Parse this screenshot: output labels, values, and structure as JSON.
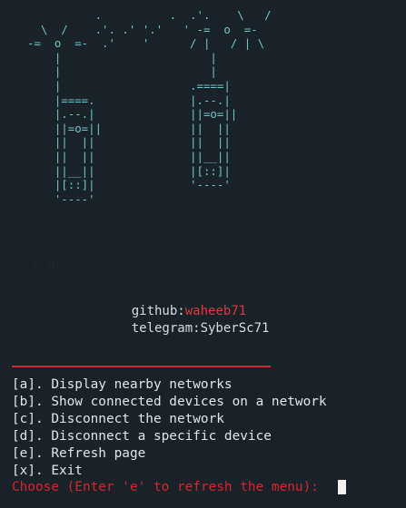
{
  "banner": {
    "art": "          .          .  .'.    \\   /\n  \\  /    .'. .' '.'   ' -=  o  =-\n-=  o  =-  .'    '      / |   / | \\\n    |                      |\n    |                      |\n    |                   .====|\n    |====.              |.--.|\n    |.--.|              ||=o=||\n    ||=o=||             ||  ||\n    ||  ||              ||  ||\n    ||  ||              ||__||\n    ||__||              |[::]|\n    |[::]|              '----'\n    '----'"
  },
  "info": {
    "github_label": "github:",
    "github_value": "waheeb71",
    "telegram_label": "telegram:",
    "telegram_value": "SyberSc71"
  },
  "menu": {
    "items": [
      "[a]. Display nearby networks",
      "[b]. Show connected devices on a network",
      "[c]. Disconnect the network",
      "[d]. Disconnect a specific device",
      "[e]. Refresh page",
      "[x]. Exit"
    ]
  },
  "prompt": {
    "text": "Choose (Enter 'e' to refresh the menu): "
  },
  "colors": {
    "art": "#6fc7ca",
    "accent_red": "#d4272c",
    "text": "#e3e6e8",
    "background": "#1a2129"
  }
}
